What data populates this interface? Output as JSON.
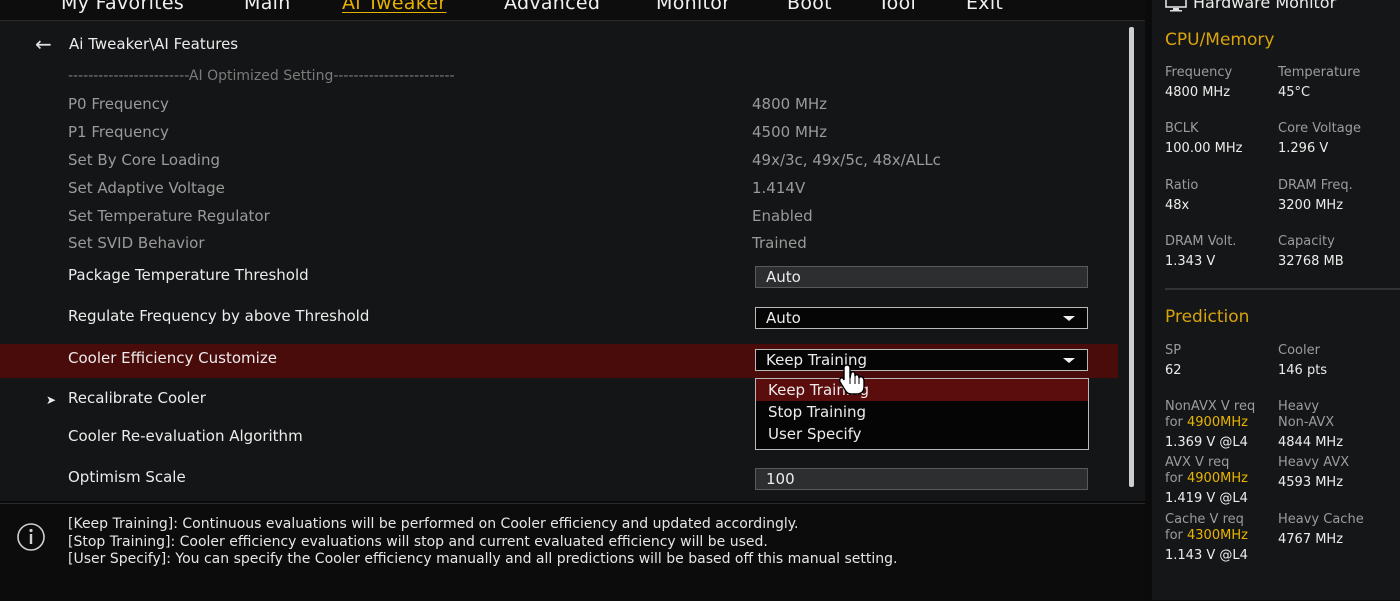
{
  "nav": {
    "tabs": [
      "My Favorites",
      "Main",
      "Ai Tweaker",
      "Advanced",
      "Monitor",
      "Boot",
      "Tool",
      "Exit"
    ],
    "active": "Ai Tweaker"
  },
  "breadcrumb": "Ai Tweaker\\AI Features",
  "section_header": "------------------------AI Optimized Setting------------------------",
  "info_rows": [
    {
      "label": "P0 Frequency",
      "value": "4800 MHz"
    },
    {
      "label": "P1 Frequency",
      "value": "4500 MHz"
    },
    {
      "label": "Set By Core Loading",
      "value": "49x/3c, 49x/5c, 48x/ALLc"
    },
    {
      "label": "Set Adaptive Voltage",
      "value": "1.414V"
    },
    {
      "label": "Set Temperature Regulator",
      "value": "Enabled"
    },
    {
      "label": "Set SVID Behavior",
      "value": "Trained"
    }
  ],
  "settings": {
    "package_temp": {
      "label": "Package Temperature Threshold",
      "value": "Auto"
    },
    "regulate_freq": {
      "label": "Regulate Frequency by above Threshold",
      "value": "Auto"
    },
    "cooler_eff": {
      "label": "Cooler Efficiency Customize",
      "value": "Keep Training"
    },
    "recalibrate": {
      "label": "Recalibrate Cooler"
    },
    "reeval": {
      "label": "Cooler Re-evaluation Algorithm"
    },
    "optimism": {
      "label": "Optimism Scale",
      "value": "100"
    }
  },
  "dropdown_options": [
    "Keep Training",
    "Stop Training",
    "User Specify"
  ],
  "dropdown_selected": "Keep Training",
  "help_lines": [
    "[Keep Training]: Continuous evaluations will be performed on Cooler efficiency and updated accordingly.",
    "[Stop Training]: Cooler efficiency evaluations will stop and current evaluated efficiency will be used.",
    "[User Specify]: You can specify the Cooler efficiency manually and all predictions will be based off this manual setting."
  ],
  "hw": {
    "title": "Hardware Monitor",
    "cpu_section": "CPU/Memory",
    "cpu": [
      {
        "label": "Frequency",
        "value": "4800 MHz"
      },
      {
        "label": "Temperature",
        "value": "45°C"
      },
      {
        "label": "BCLK",
        "value": "100.00 MHz"
      },
      {
        "label": "Core Voltage",
        "value": "1.296 V"
      },
      {
        "label": "Ratio",
        "value": "48x"
      },
      {
        "label": "DRAM Freq.",
        "value": "3200 MHz"
      },
      {
        "label": "DRAM Volt.",
        "value": "1.343 V"
      },
      {
        "label": "Capacity",
        "value": "32768 MB"
      }
    ],
    "prediction_section": "Prediction",
    "sp_label": "SP",
    "sp_value": "62",
    "cooler_label": "Cooler",
    "cooler_value": "146 pts",
    "nonavx": {
      "label": "NonAVX V req",
      "for_prefix": "for ",
      "for_freq": "4900MHz",
      "value": "1.369 V @L4"
    },
    "heavy_nonavx": {
      "label1": "Heavy",
      "label2": "Non-AVX",
      "value": "4844 MHz"
    },
    "avx": {
      "label": "AVX V req",
      "for_prefix": "for ",
      "for_freq": "4900MHz",
      "value": "1.419 V @L4"
    },
    "heavy_avx": {
      "label": "Heavy AVX",
      "value": "4593 MHz"
    },
    "cache": {
      "label": "Cache V req",
      "for_prefix": "for ",
      "for_freq": "4300MHz",
      "value": "1.143 V @L4"
    },
    "heavy_cache": {
      "label": "Heavy Cache",
      "value": "4767 MHz"
    }
  },
  "colors": {
    "accent": "#e6b000",
    "highlight_row": "#4a0b0b",
    "dropdown_active": "#5b0c0c"
  }
}
